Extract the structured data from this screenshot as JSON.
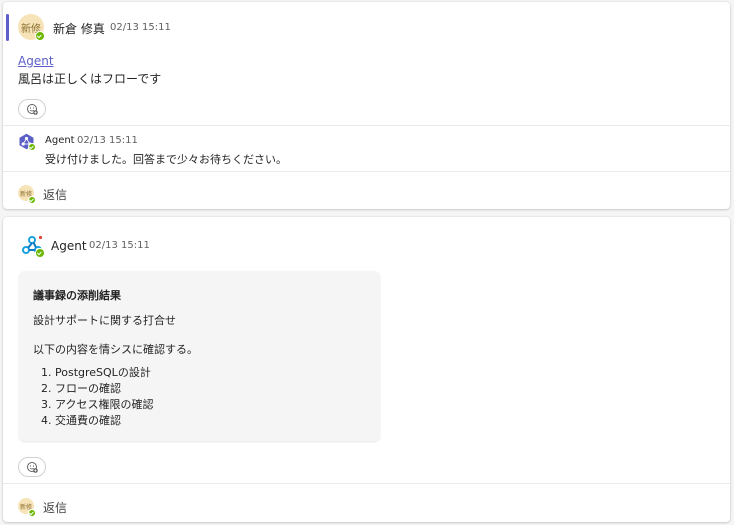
{
  "thread1": {
    "author": {
      "name": "新倉 修真",
      "initials": "新修",
      "time": "02/13 15:11"
    },
    "mention": "Agent",
    "message": "風呂は正しくはフローです",
    "reply": {
      "name": "Agent",
      "time": "02/13 15:11",
      "text": "受け付けました。回答まで少々お待ちください。"
    },
    "reply_button": "返信",
    "reply_avatar_initials": "新修"
  },
  "thread2": {
    "author": {
      "name": "Agent",
      "time": "02/13 15:11"
    },
    "card": {
      "title": "議事録の添削結果",
      "subtitle": "設計サポートに関する打合せ",
      "intro": "以下の内容を情シスに確認する。",
      "items": [
        "PostgreSQLの設計",
        "フローの確認",
        "アクセス権限の確認",
        "交通費の確認"
      ]
    },
    "reply_button": "返信",
    "reply_avatar_initials": "新修"
  },
  "icons": {
    "presence": "available-check-icon",
    "reaction": "add-reaction-icon",
    "agent": "agent-bot-icon",
    "webhook": "webhook-connector-icon"
  },
  "colors": {
    "accent": "#5b5fc7",
    "presence": "#6bb700",
    "avatar_bg": "#f6e3b8"
  }
}
